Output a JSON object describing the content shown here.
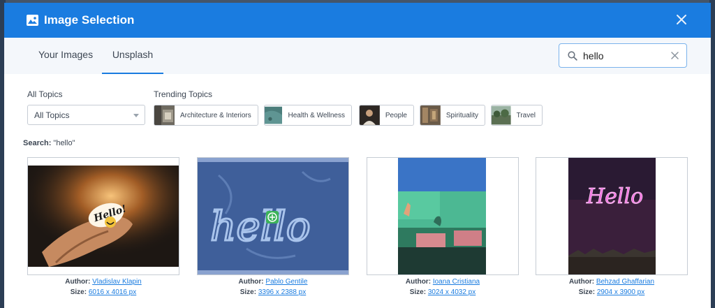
{
  "modal": {
    "title": "Image Selection",
    "header_color": "#1a7ce0",
    "icons": {
      "title": "image-icon",
      "close": "close-icon"
    }
  },
  "tabs": [
    {
      "label": "Your Images",
      "active": false
    },
    {
      "label": "Unsplash",
      "active": true
    }
  ],
  "search": {
    "value": "hello",
    "placeholder": ""
  },
  "filters": {
    "all_topics_label": "All Topics",
    "select_value": "All Topics",
    "trending_label": "Trending Topics",
    "trending": [
      {
        "label": "Architecture & Interiors"
      },
      {
        "label": "Health & Wellness"
      },
      {
        "label": "People"
      },
      {
        "label": "Spirituality"
      },
      {
        "label": "Travel"
      }
    ]
  },
  "results": {
    "search_prefix": "Search:",
    "search_query": "\"hello\"",
    "author_label": "Author:",
    "size_label": "Size:",
    "items": [
      {
        "author": "Vladislav Klapin",
        "size": "6016 x 4016 px"
      },
      {
        "author": "Pablo Gentile",
        "size": "3396 x 2388 px"
      },
      {
        "author": "Ioana Cristiana",
        "size": "3024 x 4032 px"
      },
      {
        "author": "Behzad Ghaffarian",
        "size": "2904 x 3900 px"
      }
    ]
  }
}
